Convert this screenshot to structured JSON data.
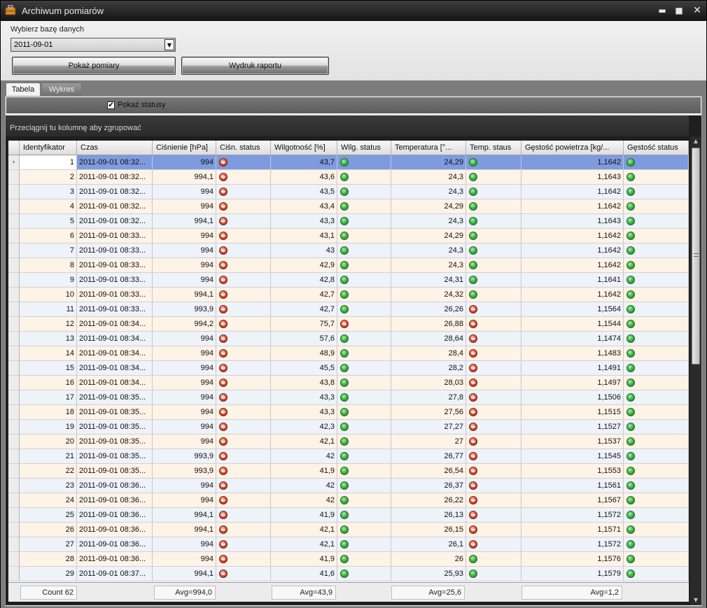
{
  "window": {
    "title": "Archiwum pomiarów",
    "min_symbol": "▬",
    "max_symbol": "■",
    "close_symbol": "✕"
  },
  "top": {
    "db_label": "Wybierz bazę danych",
    "db_value": "2011-09-01",
    "dropdown_arrow": "▼",
    "show_button": "Pokaż pomiary",
    "print_button": "Wydruk raportu"
  },
  "tabs": [
    {
      "label": "Tabela",
      "active": true
    },
    {
      "label": "Wykres",
      "active": false
    }
  ],
  "show_statuses": {
    "label": "Pokaż statusy",
    "checked": true,
    "check_symbol": "✔"
  },
  "grid": {
    "group_hint": "Przeciągnij tu kolumnę aby zgrupować",
    "columns": [
      "Identyfikator",
      "Czas",
      "Ciśnienie [hPa]",
      "Ciśn. status",
      "Wilgotność [%]",
      "Wilg. status",
      "Temperatura [°...",
      "Temp. staus",
      "Gęstość powietrza [kg/...",
      "Gęstość status"
    ],
    "row_indicator": "›",
    "selected_row": 0,
    "rows": [
      {
        "id": "1",
        "time": "2011-09-01 08:32...",
        "p": "994",
        "ps": "bad",
        "h": "43,7",
        "hs": "ok",
        "t": "24,29",
        "ts": "ok",
        "d": "1,1642",
        "ds": "ok"
      },
      {
        "id": "2",
        "time": "2011-09-01 08:32...",
        "p": "994,1",
        "ps": "bad",
        "h": "43,6",
        "hs": "ok",
        "t": "24,3",
        "ts": "ok",
        "d": "1,1643",
        "ds": "ok"
      },
      {
        "id": "3",
        "time": "2011-09-01 08:32...",
        "p": "994",
        "ps": "bad",
        "h": "43,5",
        "hs": "ok",
        "t": "24,3",
        "ts": "ok",
        "d": "1,1642",
        "ds": "ok"
      },
      {
        "id": "4",
        "time": "2011-09-01 08:32...",
        "p": "994",
        "ps": "bad",
        "h": "43,4",
        "hs": "ok",
        "t": "24,29",
        "ts": "ok",
        "d": "1,1642",
        "ds": "ok"
      },
      {
        "id": "5",
        "time": "2011-09-01 08:32...",
        "p": "994,1",
        "ps": "bad",
        "h": "43,3",
        "hs": "ok",
        "t": "24,3",
        "ts": "ok",
        "d": "1,1643",
        "ds": "ok"
      },
      {
        "id": "6",
        "time": "2011-09-01 08:33...",
        "p": "994",
        "ps": "bad",
        "h": "43,1",
        "hs": "ok",
        "t": "24,29",
        "ts": "ok",
        "d": "1,1642",
        "ds": "ok"
      },
      {
        "id": "7",
        "time": "2011-09-01 08:33...",
        "p": "994",
        "ps": "bad",
        "h": "43",
        "hs": "ok",
        "t": "24,3",
        "ts": "ok",
        "d": "1,1642",
        "ds": "ok"
      },
      {
        "id": "8",
        "time": "2011-09-01 08:33...",
        "p": "994",
        "ps": "bad",
        "h": "42,9",
        "hs": "ok",
        "t": "24,3",
        "ts": "ok",
        "d": "1,1642",
        "ds": "ok"
      },
      {
        "id": "9",
        "time": "2011-09-01 08:33...",
        "p": "994",
        "ps": "bad",
        "h": "42,8",
        "hs": "ok",
        "t": "24,31",
        "ts": "ok",
        "d": "1,1641",
        "ds": "ok"
      },
      {
        "id": "10",
        "time": "2011-09-01 08:33...",
        "p": "994,1",
        "ps": "bad",
        "h": "42,7",
        "hs": "ok",
        "t": "24,32",
        "ts": "ok",
        "d": "1,1642",
        "ds": "ok"
      },
      {
        "id": "11",
        "time": "2011-09-01 08:33...",
        "p": "993,9",
        "ps": "bad",
        "h": "42,7",
        "hs": "ok",
        "t": "26,26",
        "ts": "bad",
        "d": "1,1564",
        "ds": "ok"
      },
      {
        "id": "12",
        "time": "2011-09-01 08:34...",
        "p": "994,2",
        "ps": "bad",
        "h": "75,7",
        "hs": "bad",
        "t": "26,88",
        "ts": "bad",
        "d": "1,1544",
        "ds": "ok"
      },
      {
        "id": "13",
        "time": "2011-09-01 08:34...",
        "p": "994",
        "ps": "bad",
        "h": "57,6",
        "hs": "ok",
        "t": "28,64",
        "ts": "bad",
        "d": "1,1474",
        "ds": "ok"
      },
      {
        "id": "14",
        "time": "2011-09-01 08:34...",
        "p": "994",
        "ps": "bad",
        "h": "48,9",
        "hs": "ok",
        "t": "28,4",
        "ts": "bad",
        "d": "1,1483",
        "ds": "ok"
      },
      {
        "id": "15",
        "time": "2011-09-01 08:34...",
        "p": "994",
        "ps": "bad",
        "h": "45,5",
        "hs": "ok",
        "t": "28,2",
        "ts": "bad",
        "d": "1,1491",
        "ds": "ok"
      },
      {
        "id": "16",
        "time": "2011-09-01 08:34...",
        "p": "994",
        "ps": "bad",
        "h": "43,8",
        "hs": "ok",
        "t": "28,03",
        "ts": "bad",
        "d": "1,1497",
        "ds": "ok"
      },
      {
        "id": "17",
        "time": "2011-09-01 08:35...",
        "p": "994",
        "ps": "bad",
        "h": "43,3",
        "hs": "ok",
        "t": "27,8",
        "ts": "bad",
        "d": "1,1506",
        "ds": "ok"
      },
      {
        "id": "18",
        "time": "2011-09-01 08:35...",
        "p": "994",
        "ps": "bad",
        "h": "43,3",
        "hs": "ok",
        "t": "27,56",
        "ts": "bad",
        "d": "1,1515",
        "ds": "ok"
      },
      {
        "id": "19",
        "time": "2011-09-01 08:35...",
        "p": "994",
        "ps": "bad",
        "h": "42,3",
        "hs": "ok",
        "t": "27,27",
        "ts": "bad",
        "d": "1,1527",
        "ds": "ok"
      },
      {
        "id": "20",
        "time": "2011-09-01 08:35...",
        "p": "994",
        "ps": "bad",
        "h": "42,1",
        "hs": "ok",
        "t": "27",
        "ts": "bad",
        "d": "1,1537",
        "ds": "ok"
      },
      {
        "id": "21",
        "time": "2011-09-01 08:35...",
        "p": "993,9",
        "ps": "bad",
        "h": "42",
        "hs": "ok",
        "t": "26,77",
        "ts": "bad",
        "d": "1,1545",
        "ds": "ok"
      },
      {
        "id": "22",
        "time": "2011-09-01 08:35...",
        "p": "993,9",
        "ps": "bad",
        "h": "41,9",
        "hs": "ok",
        "t": "26,54",
        "ts": "bad",
        "d": "1,1553",
        "ds": "ok"
      },
      {
        "id": "23",
        "time": "2011-09-01 08:36...",
        "p": "994",
        "ps": "bad",
        "h": "42",
        "hs": "ok",
        "t": "26,37",
        "ts": "bad",
        "d": "1,1561",
        "ds": "ok"
      },
      {
        "id": "24",
        "time": "2011-09-01 08:36...",
        "p": "994",
        "ps": "bad",
        "h": "42",
        "hs": "ok",
        "t": "26,22",
        "ts": "bad",
        "d": "1,1567",
        "ds": "ok"
      },
      {
        "id": "25",
        "time": "2011-09-01 08:36...",
        "p": "994,1",
        "ps": "bad",
        "h": "41,9",
        "hs": "ok",
        "t": "26,13",
        "ts": "bad",
        "d": "1,1572",
        "ds": "ok"
      },
      {
        "id": "26",
        "time": "2011-09-01 08:36...",
        "p": "994,1",
        "ps": "bad",
        "h": "42,1",
        "hs": "ok",
        "t": "26,15",
        "ts": "bad",
        "d": "1,1571",
        "ds": "ok"
      },
      {
        "id": "27",
        "time": "2011-09-01 08:36...",
        "p": "994",
        "ps": "bad",
        "h": "42,1",
        "hs": "ok",
        "t": "26,1",
        "ts": "bad",
        "d": "1,1572",
        "ds": "ok"
      },
      {
        "id": "28",
        "time": "2011-09-01 08:36...",
        "p": "994",
        "ps": "bad",
        "h": "41,9",
        "hs": "ok",
        "t": "26",
        "ts": "ok",
        "d": "1,1576",
        "ds": "ok"
      },
      {
        "id": "29",
        "time": "2011-09-01 08:37...",
        "p": "994,1",
        "ps": "bad",
        "h": "41,6",
        "hs": "ok",
        "t": "25,93",
        "ts": "ok",
        "d": "1,1579",
        "ds": "ok"
      }
    ],
    "footer": {
      "count": "Count 62",
      "avg_pressure": "Avg=994,0",
      "avg_humidity": "Avg=43,9",
      "avg_temperature": "Avg=25,6",
      "avg_density": "Avg=1,2"
    },
    "scroll_up": "▲",
    "scroll_down": "▼"
  },
  "colors": {
    "selected_row": "#7f9be0",
    "status_ok": "#3fb64a",
    "status_bad": "#e4573c"
  }
}
